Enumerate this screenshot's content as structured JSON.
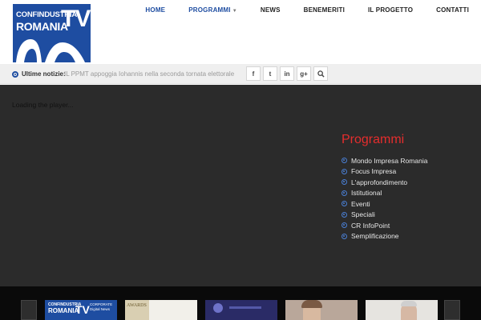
{
  "logo": {
    "line1": "CONFINDUSTRIA",
    "line2": "ROMANIA",
    "tv": "TV"
  },
  "nav": {
    "items": [
      {
        "label": "HOME"
      },
      {
        "label": "PROGRAMMI"
      },
      {
        "label": "NEWS"
      },
      {
        "label": "BENEMERITI"
      },
      {
        "label": "IL PROGETTO"
      },
      {
        "label": "CONTATTI"
      }
    ]
  },
  "ticker": {
    "label": "Ultime notizie:",
    "headline": "IL PPMT appoggia Iohannis nella seconda tornata elettorale"
  },
  "social": {
    "facebook": "f",
    "twitter": "t",
    "linkedin": "in",
    "googleplus": "g+",
    "search_icon": "search-icon"
  },
  "player": {
    "loading_text": "Loading the player..."
  },
  "programmi": {
    "title": "Programmi",
    "items": [
      "Mondo Impresa Romania",
      "Focus Impresa",
      "L'approfondimento",
      "Istitutional",
      "Eventi",
      "Speciali",
      "CR InfoPoint",
      "Semplificazione"
    ]
  },
  "carousel": {
    "thumb1": {
      "line1": "CONFINDUSTRIA",
      "line2": "ROMANIA",
      "tv": "TV",
      "caption": "CORPORATE Digital News"
    },
    "thumb2": {
      "caption": "AWARDS"
    }
  },
  "colors": {
    "brand_blue": "#1e4da1",
    "accent_red": "#e52d2d",
    "dark_bg": "#2b2b2b"
  }
}
